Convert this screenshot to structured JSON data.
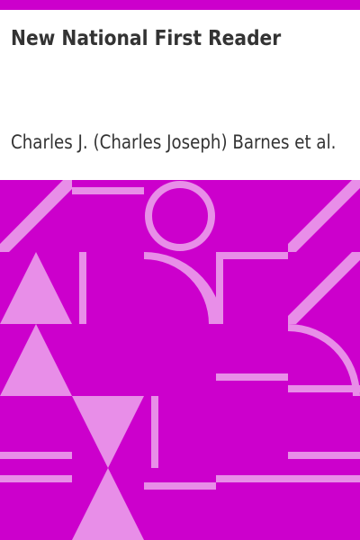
{
  "book": {
    "title": "New National First Reader",
    "author": "Charles J. (Charles Joseph) Barnes et al."
  },
  "colors": {
    "background": "#ffffff",
    "accent": "#cc00cc",
    "shape": "#e88ee8",
    "text": "#333333"
  },
  "icons": {
    "cover_art": "geometric-pattern"
  }
}
